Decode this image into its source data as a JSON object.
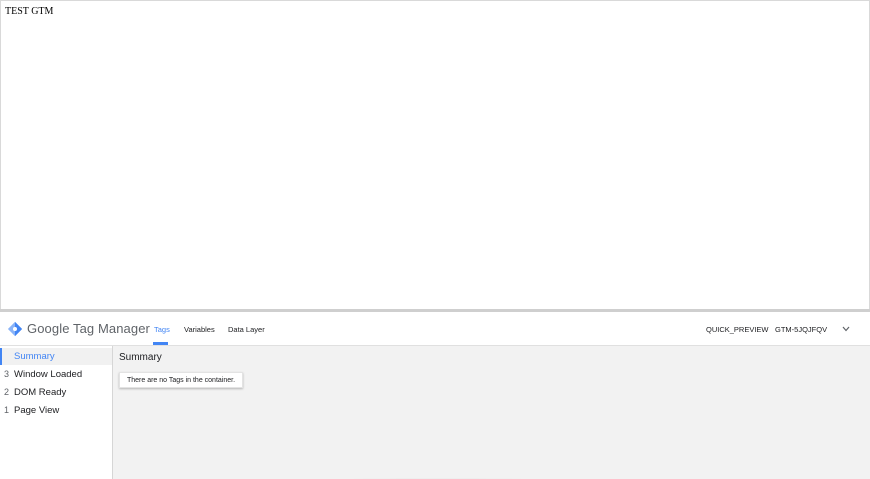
{
  "page": {
    "text": "TEST GTM"
  },
  "debug": {
    "brand": "Google Tag Manager",
    "tabs": [
      {
        "label": "Tags",
        "active": true
      },
      {
        "label": "Variables",
        "active": false
      },
      {
        "label": "Data Layer",
        "active": false
      }
    ],
    "environment": "QUICK_PREVIEW",
    "container_id": "GTM-5JQJFQV",
    "sidebar": [
      {
        "num": "",
        "label": "Summary",
        "active": true
      },
      {
        "num": "3",
        "label": "Window Loaded",
        "active": false
      },
      {
        "num": "2",
        "label": "DOM Ready",
        "active": false
      },
      {
        "num": "1",
        "label": "Page View",
        "active": false
      }
    ],
    "main": {
      "title": "Summary",
      "message": "There are no Tags in the container."
    }
  },
  "colors": {
    "accent": "#4285f4",
    "panel_bg": "#f2f2f2"
  }
}
